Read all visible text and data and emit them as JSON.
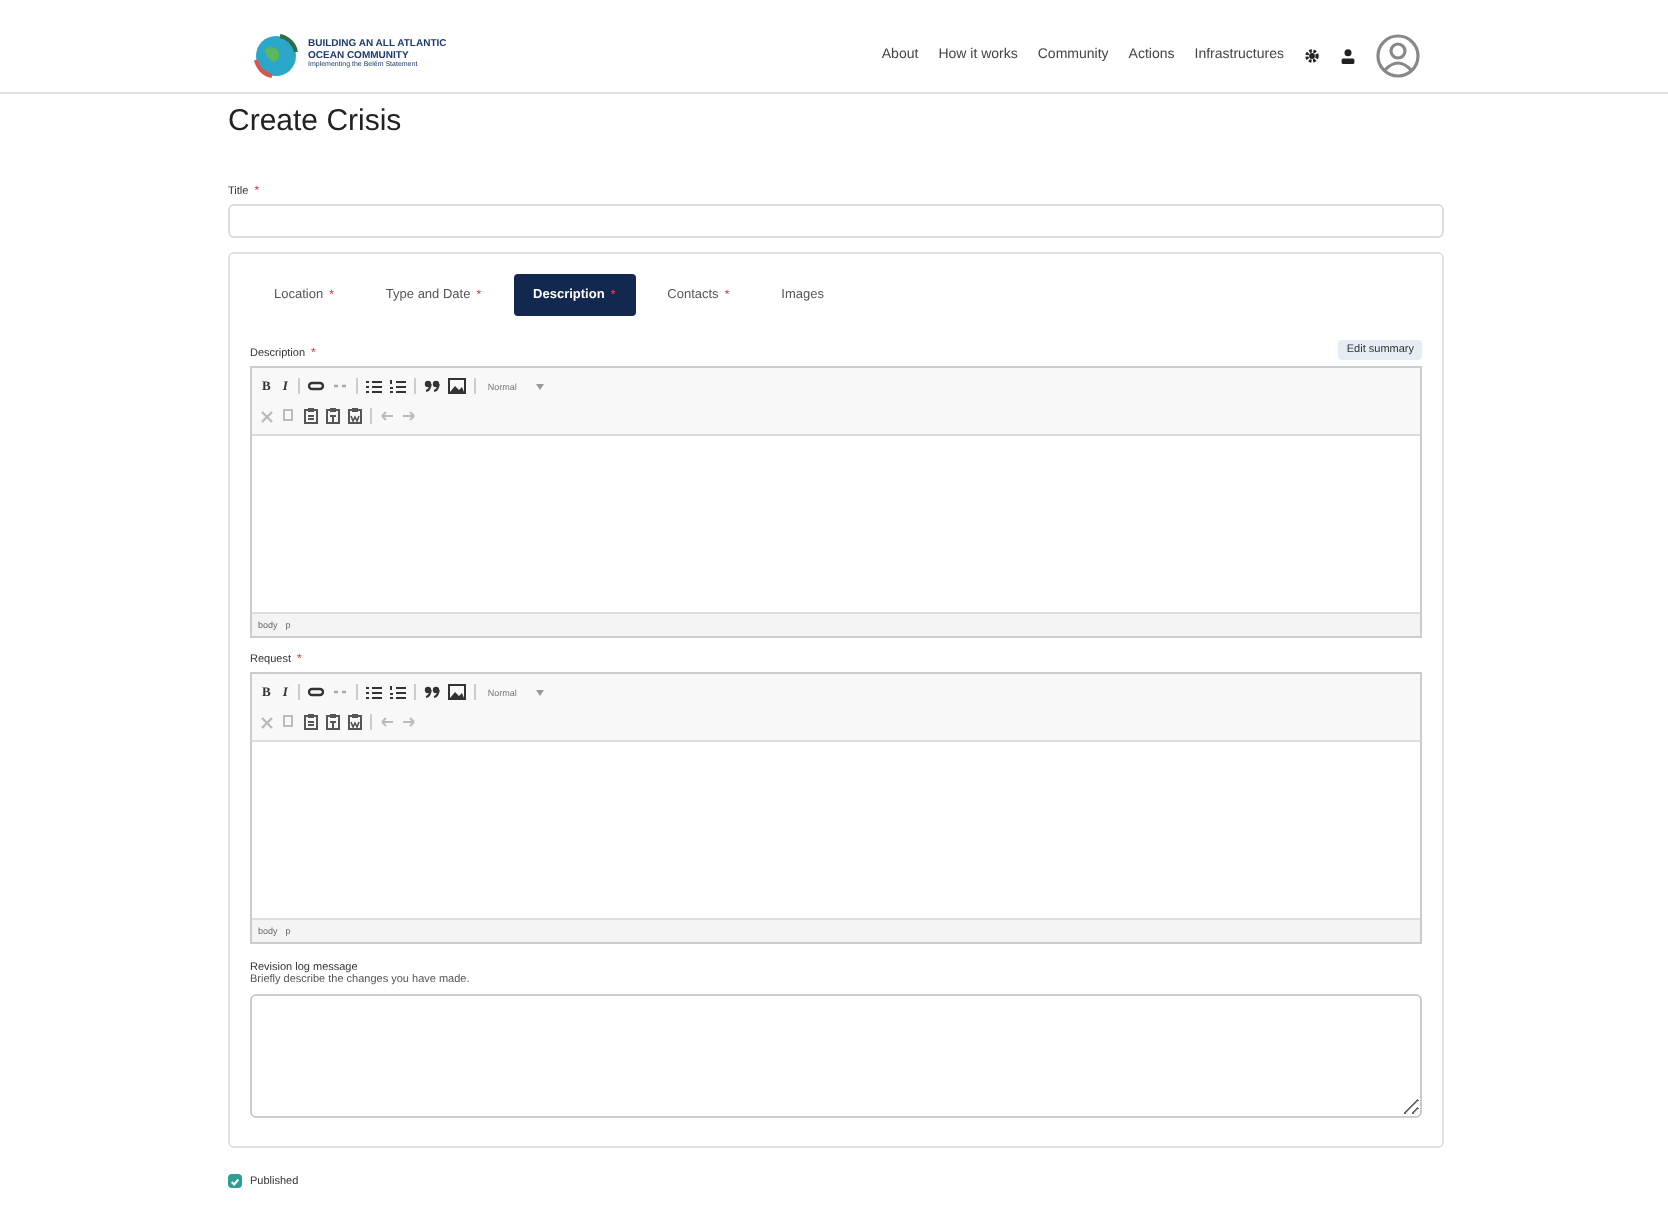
{
  "header": {
    "logo_lines": [
      "BUILDING AN ALL ATLANTIC",
      "OCEAN COMMUNITY",
      "Implementing the Belém Statement"
    ],
    "nav": [
      "About",
      "How it works",
      "Community",
      "Actions",
      "Infrastructures"
    ]
  },
  "page_title": "Create Crisis",
  "title_field": {
    "label": "Title",
    "required_mark": "*"
  },
  "tabs": [
    {
      "label": "Location",
      "required_mark": "*",
      "selected": false
    },
    {
      "label": "Type and Date",
      "required_mark": "*",
      "selected": false
    },
    {
      "label": "Description",
      "required_mark": "*",
      "selected": true
    },
    {
      "label": "Contacts",
      "required_mark": "*",
      "selected": false
    },
    {
      "label": "Images",
      "selected": false
    }
  ],
  "edit_summary": "Edit summary",
  "editors": [
    {
      "label": "Description",
      "required_mark": "*",
      "bold": "B",
      "italic": "I",
      "format": "Normal",
      "path": [
        "body",
        "p"
      ]
    },
    {
      "label": "Request",
      "required_mark": "*",
      "bold": "B",
      "italic": "I",
      "format": "Normal",
      "path": [
        "body",
        "p"
      ]
    }
  ],
  "revision": {
    "label": "Revision log message",
    "hint": "Briefly describe the changes you have made."
  },
  "published": {
    "label": "Published",
    "checked": true
  }
}
